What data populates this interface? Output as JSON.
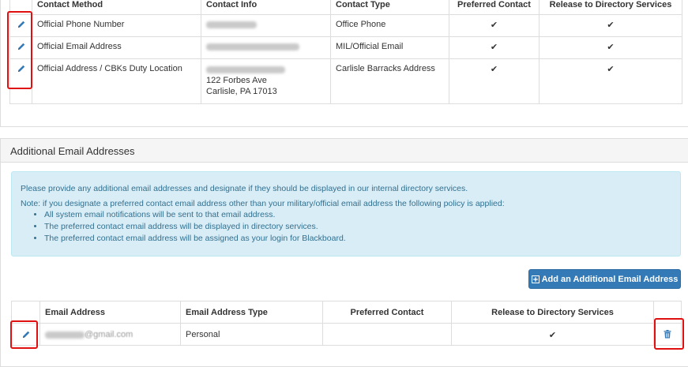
{
  "contact_table": {
    "headers": {
      "method": "Contact Method",
      "info": "Contact Info",
      "type": "Contact Type",
      "preferred": "Preferred Contact",
      "release": "Release to Directory Services"
    },
    "rows": [
      {
        "method": "Official Phone Number",
        "type": "Office Phone",
        "preferred": "✔",
        "release": "✔"
      },
      {
        "method": "Official Email Address",
        "type": "MIL/Official Email",
        "preferred": "✔",
        "release": "✔"
      },
      {
        "method": "Official Address / CBKs Duty Location",
        "address_line2": "122 Forbes Ave",
        "address_line3": "Carlisle, PA 17013",
        "type": "Carlisle Barracks Address",
        "preferred": "✔",
        "release": "✔"
      }
    ]
  },
  "email_panel": {
    "title": "Additional Email Addresses",
    "info_text": "Please provide any additional email addresses and designate if they should be displayed in our internal directory services.",
    "note_text": "Note: if you designate a preferred contact email address other than your military/official email address the following policy is applied:",
    "bullets": [
      "All system email notifications will be sent to that email address.",
      "The preferred contact email address will be displayed in directory services.",
      "The preferred contact email address will be assigned as your login for Blackboard."
    ],
    "add_button_label": "Add an Additional Email Address",
    "headers": {
      "email": "Email Address",
      "type": "Email Address Type",
      "preferred": "Preferred Contact",
      "release": "Release to Directory Services"
    },
    "rows": [
      {
        "email_suffix": "@gmail.com",
        "type": "Personal",
        "preferred": "",
        "release": "✔"
      }
    ]
  },
  "colors": {
    "accent": "#337ab7",
    "info_bg": "#d9edf7",
    "info_text": "#31708f",
    "highlight": "#e01010"
  },
  "icons": [
    "pencil-icon",
    "check-icon",
    "plus-icon",
    "trash-icon"
  ]
}
